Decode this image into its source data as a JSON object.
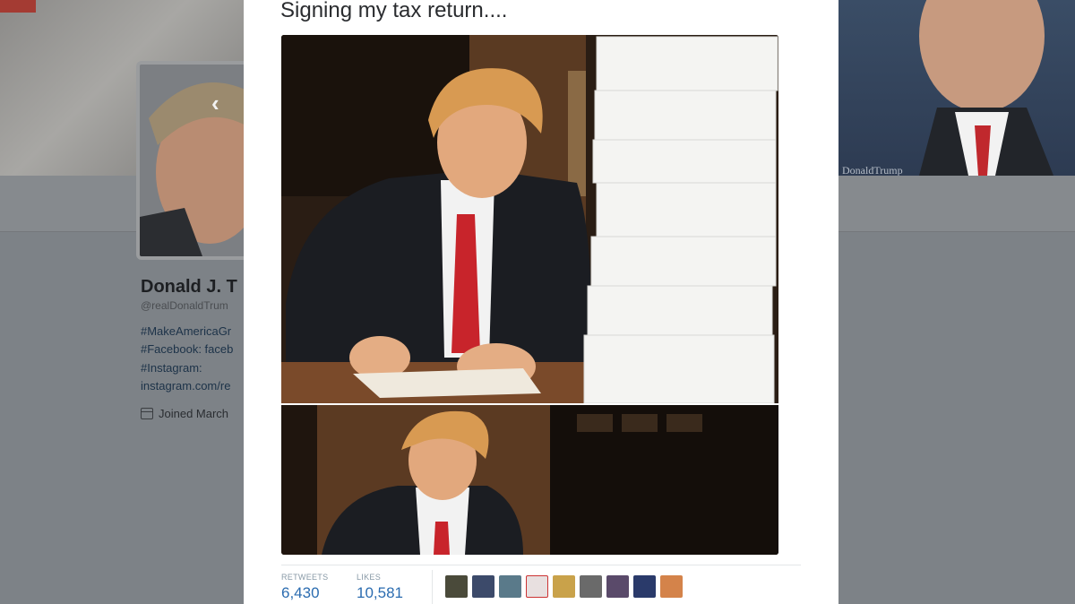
{
  "profile": {
    "name": "Donald J. T",
    "handle": "@realDonaldTrum",
    "bio_lines": [
      "#MakeAmericaGr",
      "#Facebook: faceb",
      "#Instagram:",
      "instagram.com/re"
    ],
    "joined": "Joined March",
    "header_caption": "DonaldTrump"
  },
  "tweet": {
    "text": "Signing my tax return....",
    "stats": {
      "retweets_label": "RETWEETS",
      "retweets_value": "6,430",
      "likes_label": "LIKES",
      "likes_value": "10,581"
    }
  },
  "likers": [
    "liker-1",
    "liker-2",
    "liker-3",
    "liker-4",
    "liker-5",
    "liker-6",
    "liker-7",
    "liker-8",
    "liker-9"
  ],
  "colors": {
    "accent": "#2b6cb0",
    "overlay": "#7d8287",
    "modal_bg": "#ffffff"
  },
  "icons": [
    "back-arrow-icon",
    "calendar-icon"
  ]
}
